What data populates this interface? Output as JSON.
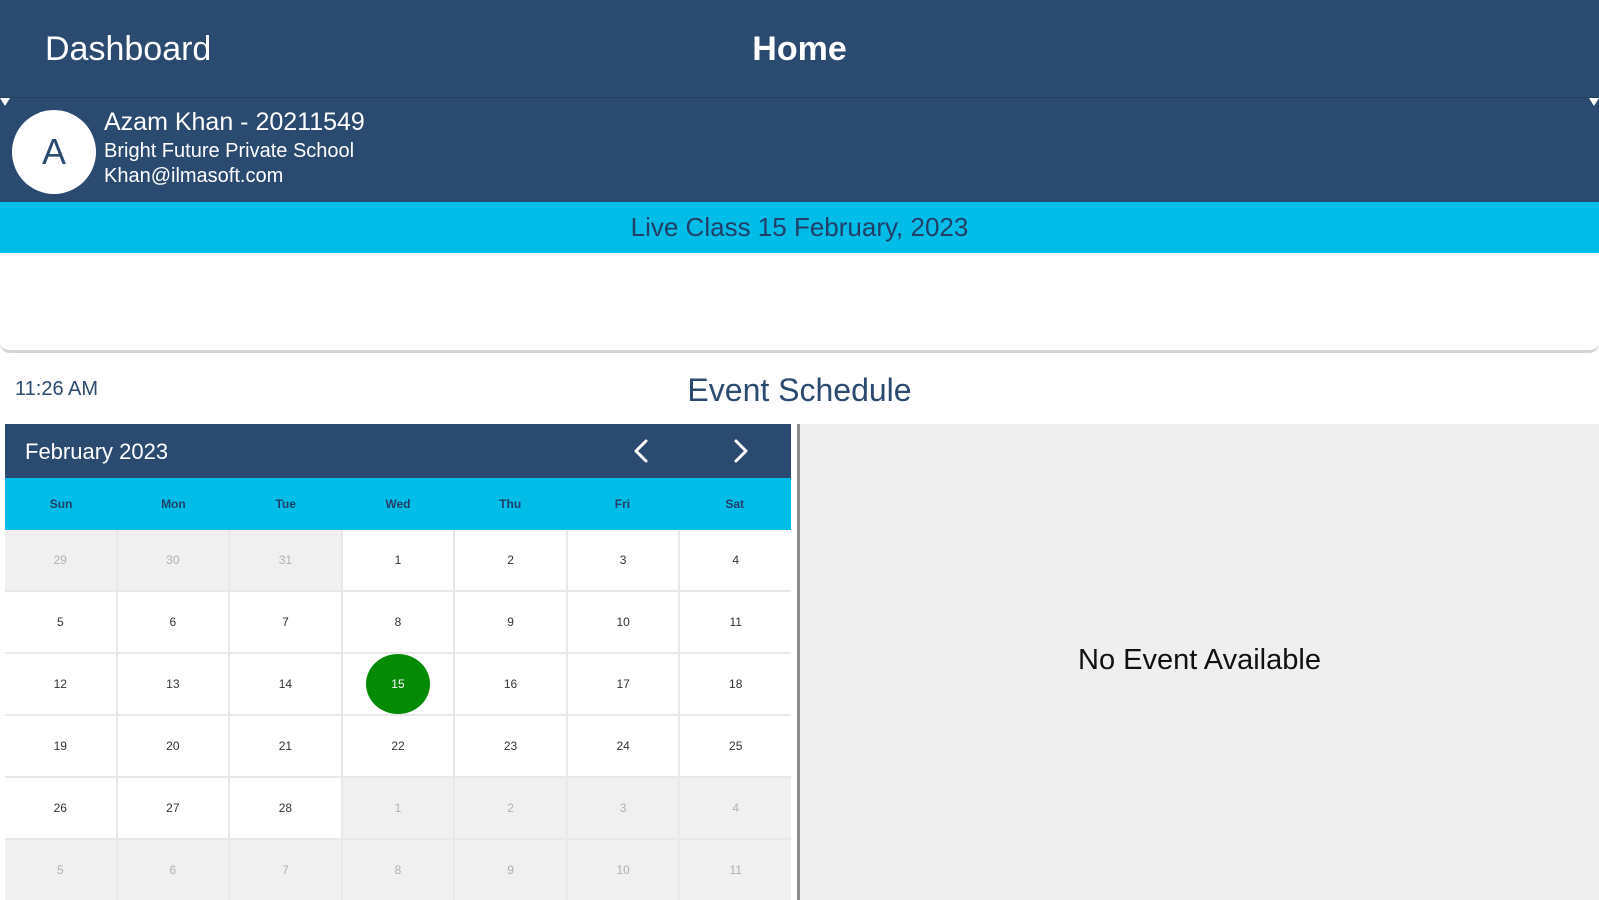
{
  "header": {
    "left_label": "Dashboard",
    "title": "Home"
  },
  "profile": {
    "avatar_letter": "A",
    "name": "Azam Khan - 20211549",
    "school": "Bright Future Private School",
    "email": "Khan@ilmasoft.com"
  },
  "live_class": {
    "label": "Live Class 15 February, 2023"
  },
  "schedule": {
    "time": "11:26 AM",
    "title": "Event Schedule",
    "empty_message": "No Event Available"
  },
  "calendar": {
    "month_label": "February 2023",
    "prev_icon": "chevron-left-icon",
    "next_icon": "chevron-right-icon",
    "weekdays": [
      "Sun",
      "Mon",
      "Tue",
      "Wed",
      "Thu",
      "Fri",
      "Sat"
    ],
    "selected_day": "15",
    "selected_color": "#058a05",
    "weeks": [
      [
        {
          "d": "29",
          "o": true
        },
        {
          "d": "30",
          "o": true
        },
        {
          "d": "31",
          "o": true
        },
        {
          "d": "1"
        },
        {
          "d": "2"
        },
        {
          "d": "3"
        },
        {
          "d": "4"
        }
      ],
      [
        {
          "d": "5"
        },
        {
          "d": "6"
        },
        {
          "d": "7"
        },
        {
          "d": "8"
        },
        {
          "d": "9"
        },
        {
          "d": "10"
        },
        {
          "d": "11"
        }
      ],
      [
        {
          "d": "12"
        },
        {
          "d": "13"
        },
        {
          "d": "14"
        },
        {
          "d": "15",
          "s": true
        },
        {
          "d": "16"
        },
        {
          "d": "17"
        },
        {
          "d": "18"
        }
      ],
      [
        {
          "d": "19"
        },
        {
          "d": "20"
        },
        {
          "d": "21"
        },
        {
          "d": "22"
        },
        {
          "d": "23"
        },
        {
          "d": "24"
        },
        {
          "d": "25"
        }
      ],
      [
        {
          "d": "26"
        },
        {
          "d": "27"
        },
        {
          "d": "28"
        },
        {
          "d": "1",
          "o": true
        },
        {
          "d": "2",
          "o": true
        },
        {
          "d": "3",
          "o": true
        },
        {
          "d": "4",
          "o": true
        }
      ],
      [
        {
          "d": "5",
          "o": true
        },
        {
          "d": "6",
          "o": true
        },
        {
          "d": "7",
          "o": true
        },
        {
          "d": "8",
          "o": true
        },
        {
          "d": "9",
          "o": true
        },
        {
          "d": "10",
          "o": true
        },
        {
          "d": "11",
          "o": true
        }
      ]
    ]
  },
  "colors": {
    "navy": "#2b4a6f",
    "cyan": "#00bde8"
  }
}
